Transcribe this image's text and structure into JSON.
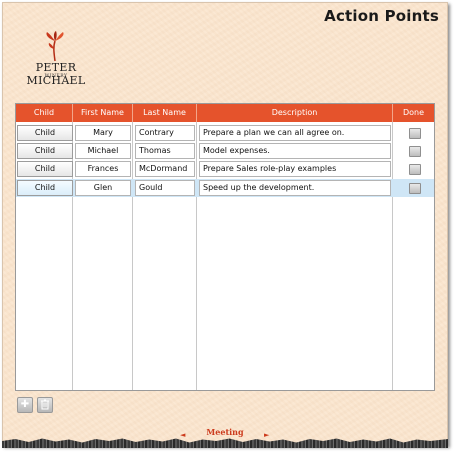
{
  "page": {
    "title": "Action Points"
  },
  "logo": {
    "name": "PETER MICHAEL",
    "sub": "WINERY"
  },
  "grid": {
    "columns": [
      "Child",
      "First Name",
      "Last Name",
      "Description",
      "Done"
    ],
    "rows": [
      {
        "child": "Child",
        "first": "Mary",
        "last": "Contrary",
        "description": "Prepare a plan we can all agree on.",
        "done": false
      },
      {
        "child": "Child",
        "first": "Michael",
        "last": "Thomas",
        "description": "Model expenses.",
        "done": false
      },
      {
        "child": "Child",
        "first": "Frances",
        "last": "McDormand",
        "description": "Prepare Sales role-play examples",
        "done": false
      },
      {
        "child": "Child",
        "first": "Glen",
        "last": "Gould",
        "description": "Speed up the development.",
        "done": false
      }
    ],
    "selected_row": 4
  },
  "toolbar": {
    "add_icon": "add-icon",
    "delete_icon": "trash-icon"
  },
  "footer": {
    "label": "Meeting",
    "left_arrow": "◄",
    "right_arrow": "►"
  },
  "colors": {
    "header_bg": "#e5532c",
    "accent": "#cc3a1c",
    "selected_row": "#cfe6f6",
    "background": "#fbe6cf"
  }
}
